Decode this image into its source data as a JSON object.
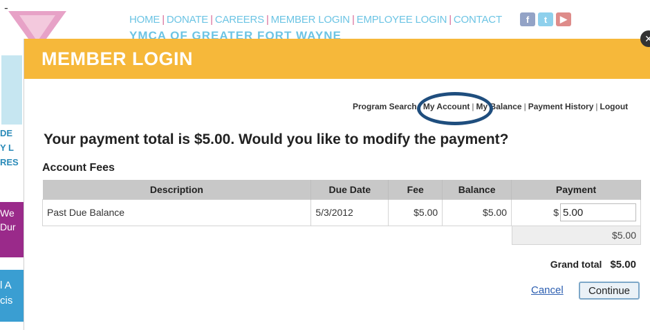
{
  "background": {
    "dash": "-",
    "nav": [
      "HOME",
      "DONATE",
      "CAREERS",
      "MEMBER LOGIN",
      "EMPLOYEE LOGIN",
      "CONTACT"
    ],
    "nav_separator": "|",
    "org_name": "YMCA OF GREATER FORT WAYNE",
    "social_icons": [
      "facebook-icon",
      "twitter-icon",
      "youtube-icon"
    ],
    "left_strip_text": [
      "DE",
      "Y L",
      "RES"
    ],
    "left_strip_pink_text": [
      "We",
      "Dur"
    ],
    "left_strip_blue_text": [
      "l A",
      "cis"
    ]
  },
  "modal": {
    "title": "MEMBER LOGIN",
    "sub_nav": [
      "Program Search",
      "My Account",
      "My Balance",
      "Payment History",
      "Logout"
    ],
    "sub_nav_separator": "|",
    "headline": "Your payment total is $5.00. Would you like to modify the payment?",
    "section_title": "Account Fees",
    "table": {
      "headers": [
        "Description",
        "Due Date",
        "Fee",
        "Balance",
        "Payment"
      ],
      "rows": [
        {
          "description": "Past Due Balance",
          "due_date": "5/3/2012",
          "fee": "$5.00",
          "balance": "$5.00",
          "payment_prefix": "$",
          "payment_value": "5.00"
        }
      ],
      "subtotal": "$5.00"
    },
    "grand_total_label": "Grand total",
    "grand_total_value": "$5.00",
    "cancel_label": "Cancel",
    "continue_label": "Continue"
  },
  "colors": {
    "header_bg": "#f6b83a",
    "nav_text": "#6cc4e4",
    "highlight_ring": "#1f4e7e",
    "link": "#2a5db0"
  }
}
